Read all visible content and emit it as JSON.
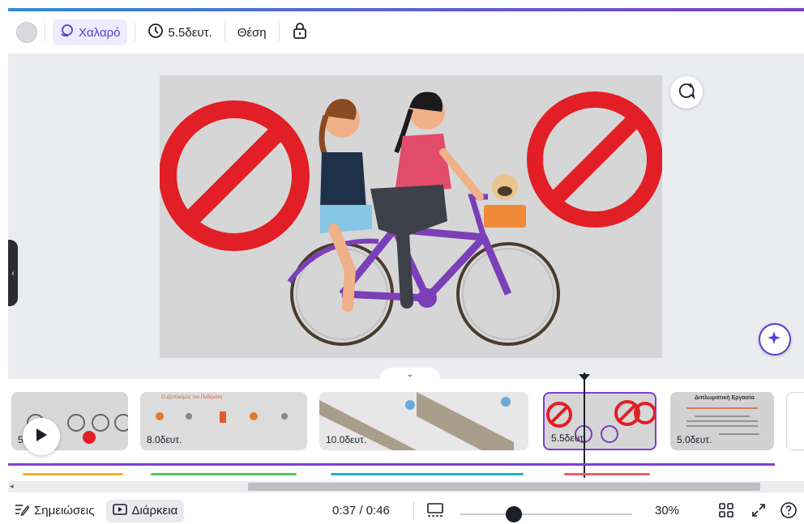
{
  "toolbar": {
    "animation_label": "Χαλαρό",
    "duration_label": "5.5δευτ.",
    "position_label": "Θέση"
  },
  "timeline": {
    "thumbnails": [
      {
        "label": "5",
        "id": "t1"
      },
      {
        "label": "8.0δευτ.",
        "id": "t2",
        "caption": "Ο εξοπλισμός του Ποδηλάτη"
      },
      {
        "label": "10.0δευτ.",
        "id": "t3"
      },
      {
        "label": "5.5δευτ.",
        "id": "t4"
      },
      {
        "label": "5.0δευτ.",
        "id": "t5",
        "caption": "Διπλωματική Εργασία"
      }
    ],
    "segment_colors": [
      "#f2b01e",
      "#54c653",
      "#1fb2c9",
      "#ee5b6b"
    ],
    "audio_color": "#7d3fd0"
  },
  "bottombar": {
    "notes_label": "Σημειώσεις",
    "duration_label": "Διάρκεια",
    "time_display": "0:37 / 0:46",
    "zoom_label": "30%",
    "zoom_fraction": 0.3
  },
  "colors": {
    "accent": "#7d3fd0",
    "anim_bg": "#eeeaff",
    "anim_text": "#5a3dd1",
    "no_sign": "#e21f26",
    "bike": "#7b3fb8"
  }
}
